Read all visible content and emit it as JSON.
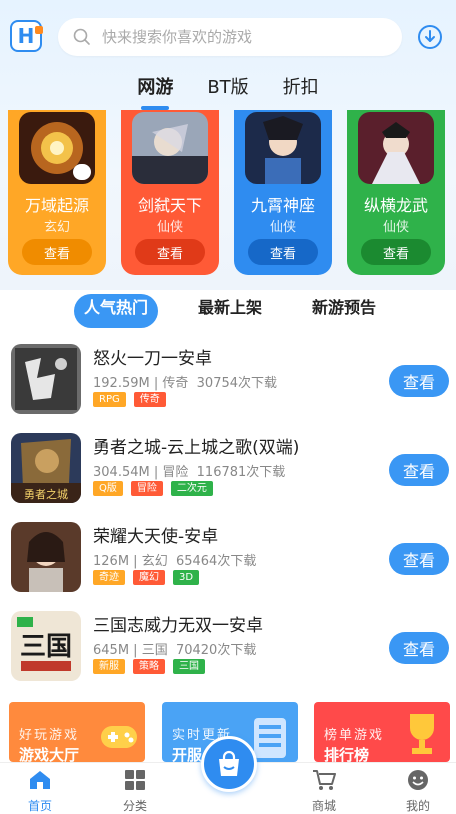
{
  "header": {
    "search_placeholder": "快来搜索你喜欢的游戏",
    "logo_letter": "H"
  },
  "tabs": [
    {
      "label": "网游",
      "active": true
    },
    {
      "label": "BT版",
      "active": false
    },
    {
      "label": "折扣",
      "active": false
    }
  ],
  "featured": [
    {
      "name": "万域起源",
      "genre": "玄幻",
      "button": "查看",
      "color": "#ffa726",
      "btn_color": "#f08c00"
    },
    {
      "name": "剑弑天下",
      "genre": "仙侠",
      "button": "查看",
      "color": "#ff5a36",
      "btn_color": "#e03a18"
    },
    {
      "name": "九霄神座",
      "genre": "仙侠",
      "button": "查看",
      "color": "#2f8cf0",
      "btn_color": "#1668c8"
    },
    {
      "name": "纵横龙武",
      "genre": "仙侠",
      "button": "查看",
      "color": "#2fb24a",
      "btn_color": "#1b8a30"
    }
  ],
  "subtabs": [
    {
      "label": "人气热门",
      "active": true
    },
    {
      "label": "最新上架",
      "active": false
    },
    {
      "label": "新游预告",
      "active": false
    }
  ],
  "games": [
    {
      "title": "怒火一刀一安卓",
      "size": "192.59M",
      "category": "传奇",
      "downloads": "30754次下载",
      "tags": [
        {
          "text": "RPG",
          "color": "#ffa726"
        },
        {
          "text": "传奇",
          "color": "#ff5a36"
        }
      ],
      "button": "查看"
    },
    {
      "title": "勇者之城-云上城之歌(双端)",
      "size": "304.54M",
      "category": "冒险",
      "downloads": "116781次下载",
      "tags": [
        {
          "text": "Q版",
          "color": "#ffa726"
        },
        {
          "text": "冒险",
          "color": "#ff5a36"
        },
        {
          "text": "二次元",
          "color": "#2fb24a"
        }
      ],
      "button": "查看"
    },
    {
      "title": "荣耀大天使-安卓",
      "size": "126M",
      "category": "玄幻",
      "downloads": "65464次下载",
      "tags": [
        {
          "text": "奇迹",
          "color": "#ffa726"
        },
        {
          "text": "魔幻",
          "color": "#ff5a36"
        },
        {
          "text": "3D",
          "color": "#2fb24a"
        }
      ],
      "button": "查看"
    },
    {
      "title": "三国志威力无双一安卓",
      "size": "645M",
      "category": "三国",
      "downloads": "70420次下载",
      "tags": [
        {
          "text": "新服",
          "color": "#ffa726"
        },
        {
          "text": "策略",
          "color": "#ff5a36"
        },
        {
          "text": "三国",
          "color": "#2fb24a"
        }
      ],
      "button": "查看"
    }
  ],
  "banners": [
    {
      "line1": "好玩游戏",
      "line2": "游戏大厅",
      "color": "#ff8a3d"
    },
    {
      "line1": "实时更新",
      "line2": "开服",
      "color": "#4aa3f5"
    },
    {
      "line1": "榜单游戏",
      "line2": "排行榜",
      "color": "#ff4a4a"
    }
  ],
  "nav": [
    {
      "label": "首页",
      "icon": "home-icon",
      "active": true
    },
    {
      "label": "分类",
      "icon": "grid-icon",
      "active": false
    },
    {
      "label": "商城",
      "icon": "cart-icon",
      "active": false
    },
    {
      "label": "我的",
      "icon": "profile-icon",
      "active": false
    }
  ],
  "colors": {
    "accent": "#2f8cf0"
  }
}
